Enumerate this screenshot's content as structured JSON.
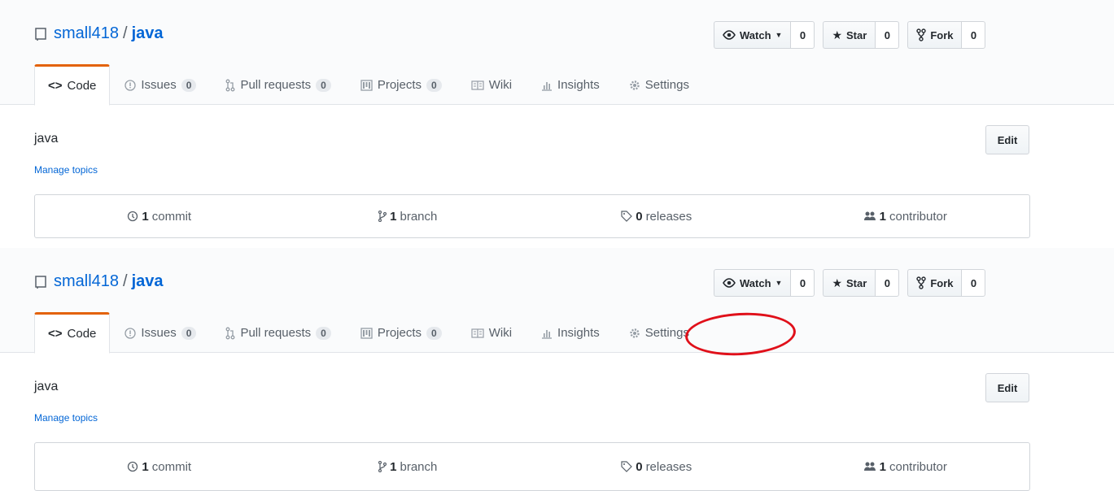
{
  "repo": {
    "owner": "small418",
    "separator": "/",
    "name": "java"
  },
  "actions": {
    "watch": {
      "label": "Watch",
      "count": "0"
    },
    "star": {
      "label": "Star",
      "count": "0"
    },
    "fork": {
      "label": "Fork",
      "count": "0"
    }
  },
  "tabs": [
    {
      "label": "Code",
      "icon": "code-icon"
    },
    {
      "label": "Issues",
      "icon": "issue-icon",
      "count": "0"
    },
    {
      "label": "Pull requests",
      "icon": "pull-request-icon",
      "count": "0"
    },
    {
      "label": "Projects",
      "icon": "project-icon",
      "count": "0"
    },
    {
      "label": "Wiki",
      "icon": "book-icon"
    },
    {
      "label": "Insights",
      "icon": "graph-icon"
    },
    {
      "label": "Settings",
      "icon": "gear-icon"
    }
  ],
  "description": "java",
  "manage_topics": "Manage topics",
  "edit_label": "Edit",
  "summary": {
    "commits": {
      "num": "1",
      "label": "commit"
    },
    "branches": {
      "num": "1",
      "label": "branch"
    },
    "releases": {
      "num": "0",
      "label": "releases"
    },
    "contributors": {
      "num": "1",
      "label": "contributor"
    }
  },
  "colors": {
    "accent": "#e36209",
    "link": "#0366d6",
    "annotation": "#e0101a"
  }
}
